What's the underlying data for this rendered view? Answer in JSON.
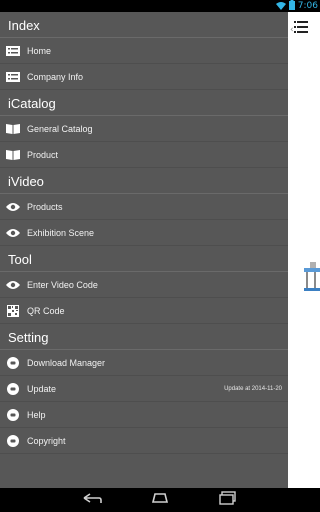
{
  "status": {
    "time": "7:06"
  },
  "sections": [
    {
      "header": "Index",
      "items": [
        {
          "label": "Home",
          "icon": "list-icon",
          "extra": ""
        },
        {
          "label": "Company Info",
          "icon": "list-icon",
          "extra": ""
        }
      ]
    },
    {
      "header": "iCatalog",
      "items": [
        {
          "label": "General Catalog",
          "icon": "book-icon",
          "extra": ""
        },
        {
          "label": "Product",
          "icon": "book-icon",
          "extra": ""
        }
      ]
    },
    {
      "header": "iVideo",
      "items": [
        {
          "label": "Products",
          "icon": "eye-icon",
          "extra": ""
        },
        {
          "label": "Exhibition Scene",
          "icon": "eye-icon",
          "extra": ""
        }
      ]
    },
    {
      "header": "Tool",
      "items": [
        {
          "label": "Enter Video Code",
          "icon": "eye-icon",
          "extra": ""
        },
        {
          "label": "QR Code",
          "icon": "qr-code-icon",
          "extra": ""
        }
      ]
    },
    {
      "header": "Setting",
      "items": [
        {
          "label": "Download Manager",
          "icon": "circle-icon",
          "extra": ""
        },
        {
          "label": "Update",
          "icon": "circle-icon",
          "extra": "Update at 2014-11-20"
        },
        {
          "label": "Help",
          "icon": "circle-icon",
          "extra": ""
        },
        {
          "label": "Copyright",
          "icon": "circle-icon",
          "extra": ""
        }
      ]
    }
  ]
}
